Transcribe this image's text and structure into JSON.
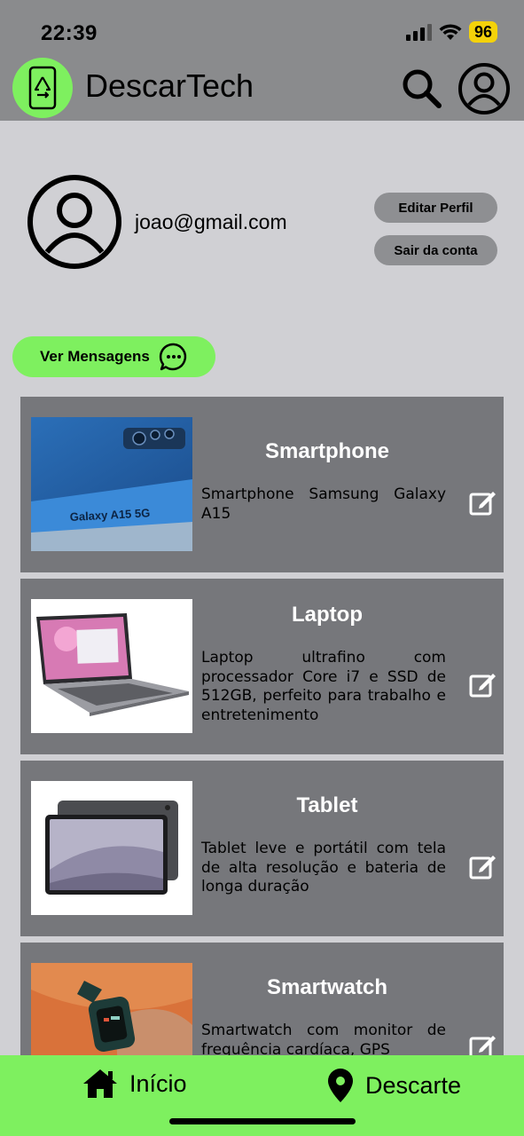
{
  "status_bar": {
    "time": "22:39",
    "battery": "96"
  },
  "header": {
    "app_title": "DescarTech"
  },
  "profile": {
    "email": "joao@gmail.com",
    "edit_label": "Editar Perfil",
    "logout_label": "Sair da conta"
  },
  "messages": {
    "label": "Ver Mensagens"
  },
  "products": [
    {
      "title": "Smartphone",
      "description": "Smartphone Samsung Galaxy A15",
      "image_text": "Galaxy A15 5G"
    },
    {
      "title": "Laptop",
      "description": "Laptop ultrafino com processador Core i7 e SSD de 512GB, perfeito para trabalho e entretenimento"
    },
    {
      "title": "Tablet",
      "description": "Tablet leve e portátil com tela de alta resolução e bateria de longa duração"
    },
    {
      "title": "Smartwatch",
      "description": "Smartwatch com monitor de frequência cardíaca, GPS"
    }
  ],
  "bottom_nav": {
    "home_label": "Início",
    "descarte_label": "Descarte"
  },
  "colors": {
    "accent_green": "#7ef05f",
    "header_gray": "#8a8b8d",
    "card_gray": "#76777b",
    "page_bg": "#d0d0d4",
    "battery_yellow": "#f4d20a"
  },
  "icons": [
    "recycle-phone-logo-icon",
    "search-icon",
    "account-icon",
    "chat-bubble-icon",
    "edit-icon",
    "home-icon",
    "location-pin-icon"
  ]
}
